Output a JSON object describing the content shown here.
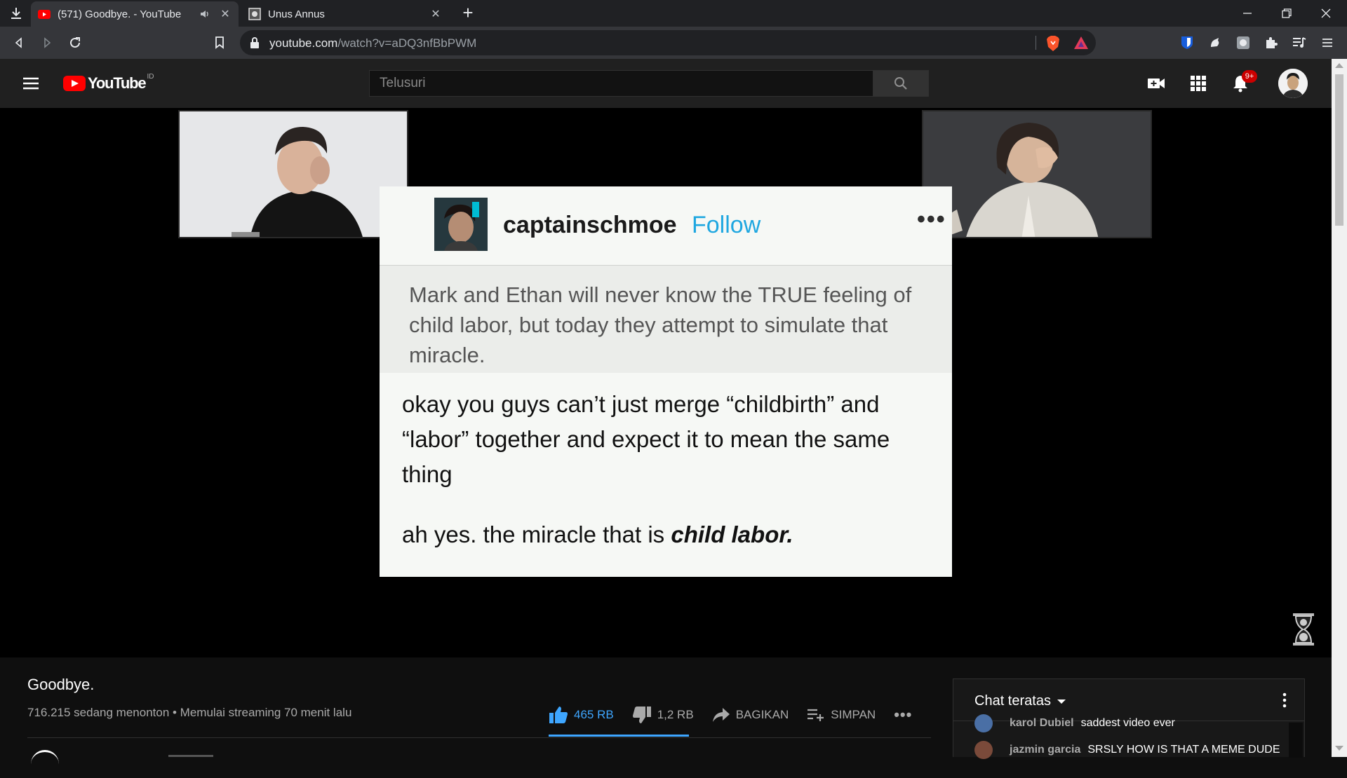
{
  "browser": {
    "tabs": [
      {
        "title": "(571) Goodbye. - YouTube",
        "active": true,
        "audible": true
      },
      {
        "title": "Unus Annus",
        "active": false,
        "audible": false
      }
    ],
    "new_tab_label": "+",
    "url_domain": "youtube.com",
    "url_path": "/watch?v=aDQ3nfBbPWM"
  },
  "youtube": {
    "wordmark": "YouTube",
    "country_code": "ID",
    "search_placeholder": "Telusuri",
    "notification_count": "9+"
  },
  "video_frame": {
    "post": {
      "username": "captainschmoe",
      "follow_label": "Follow",
      "more_label": "•••",
      "quote": "Mark and Ethan will never know the TRUE feeling of child labor, but today they attempt to simulate that miracle.",
      "reply": "okay you guys can’t just merge “childbirth” and “labor” together and expect it to mean the same thing",
      "reply2_prefix": "ah yes. the miracle that is ",
      "reply2_emphasis": "child labor."
    }
  },
  "video": {
    "title": "Goodbye.",
    "meta": "716.215 sedang menonton • Memulai streaming 70 menit lalu",
    "like_count": "465 RB",
    "dislike_count": "1,2 RB",
    "share_label": "BAGIKAN",
    "save_label": "SIMPAN",
    "more_label": "•••"
  },
  "chat": {
    "title": "Chat teratas",
    "messages": [
      {
        "author": "karol Dubiel",
        "text": "saddest video ever"
      },
      {
        "author": "jazmin garcia",
        "text": "SRSLY HOW IS THAT A MEME DUDE"
      }
    ]
  },
  "colors": {
    "youtube_red": "#ff0000",
    "link_blue": "#3ea6ff",
    "tumblr_follow": "#1fa7e0"
  }
}
